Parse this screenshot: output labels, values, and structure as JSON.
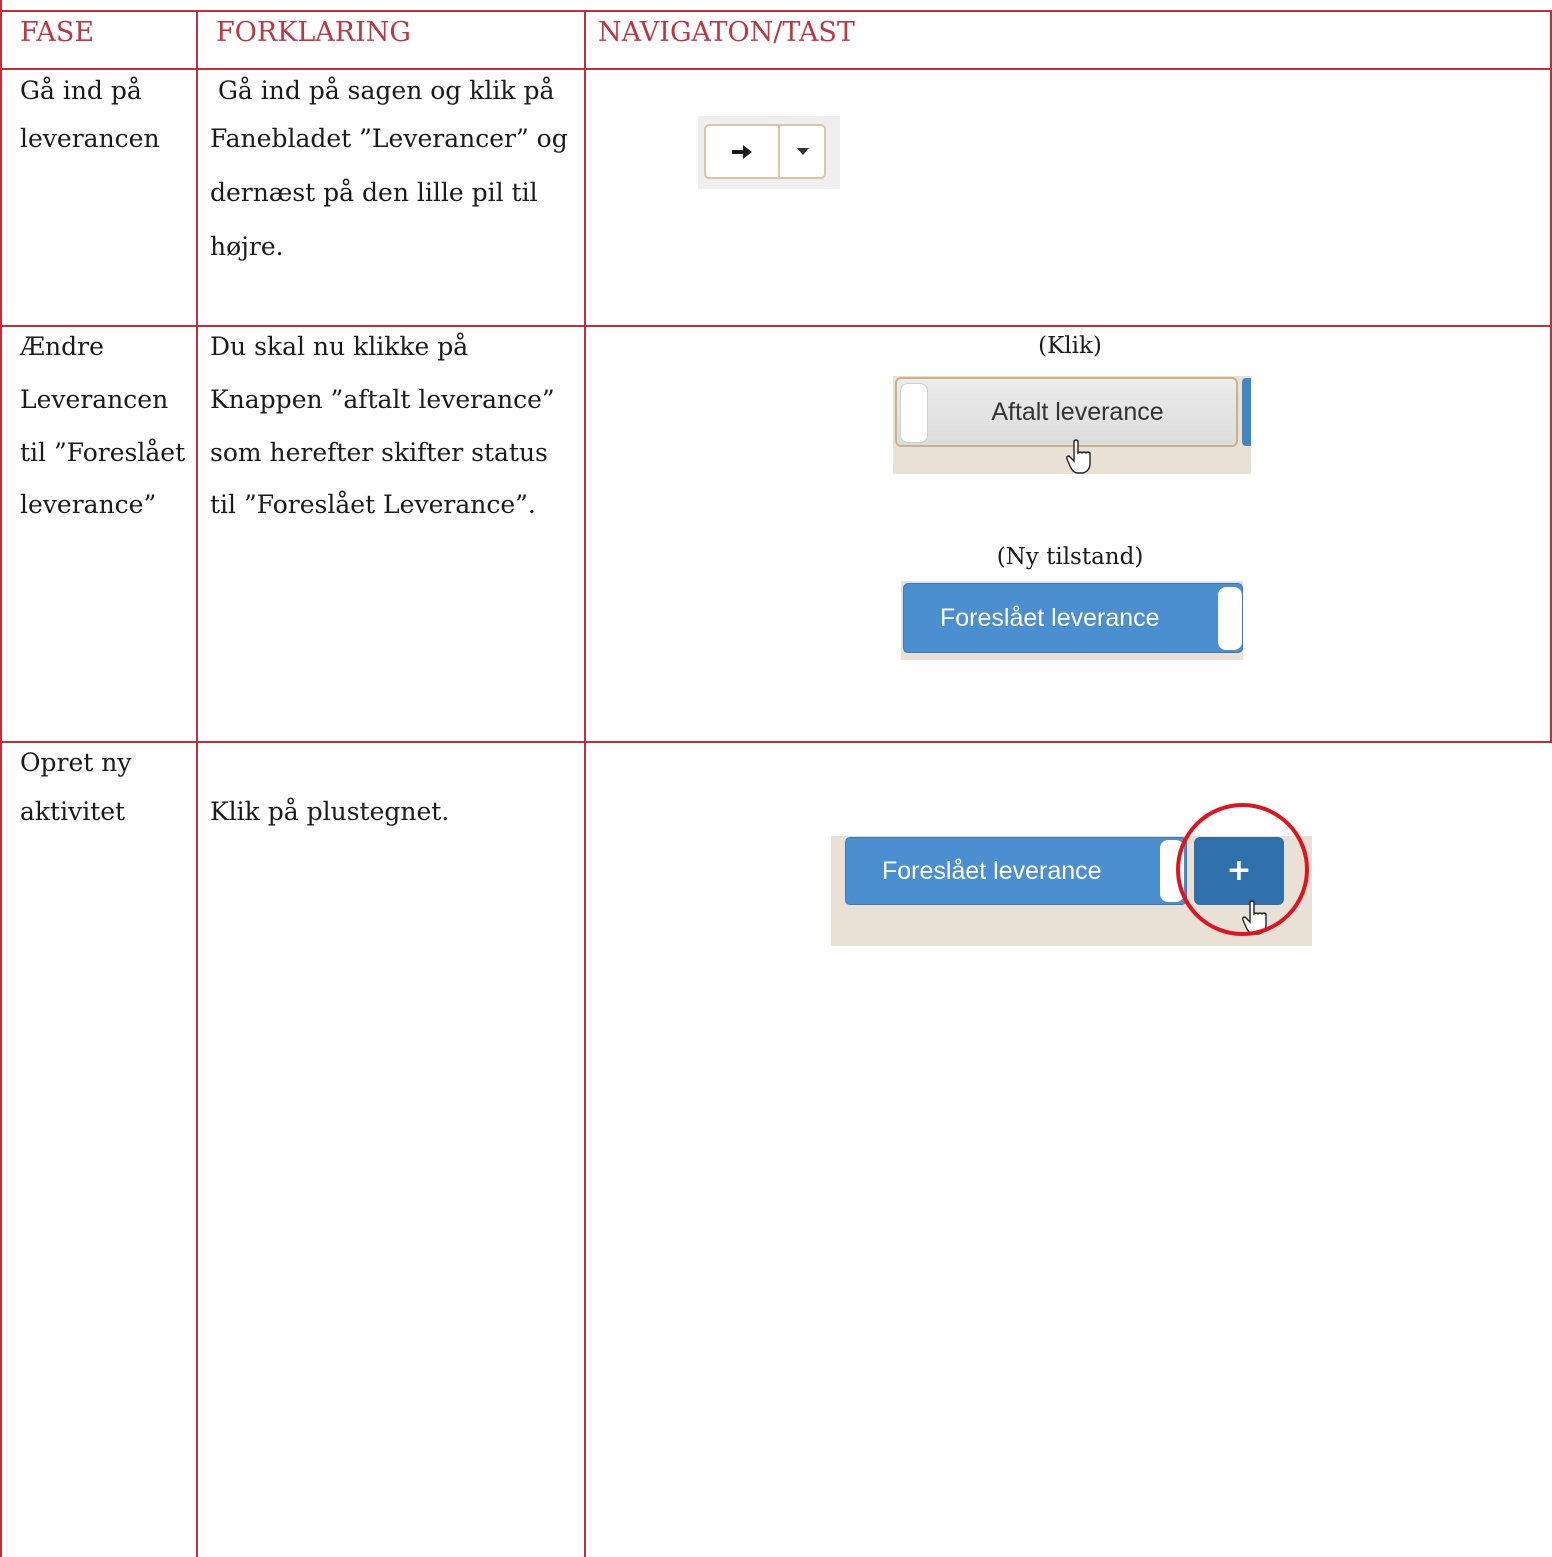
{
  "table": {
    "headers": {
      "phase": "FASE",
      "explanation": "FORKLARING",
      "navigation": "NAVIGATON/TAST"
    },
    "rows": [
      {
        "phase": [
          "Gå ind på",
          "leverancen"
        ],
        "explanation": [
          " Gå ind på sagen og klik på",
          "Fanebladet ”Leverancer” og",
          "dernæst på den lille pil til",
          "højre."
        ]
      },
      {
        "phase": [
          "Ændre",
          "Leverancen",
          "til ”Foreslået",
          "leverance”"
        ],
        "explanation": [
          "Du skal nu klikke på",
          "Knappen ”aftalt leverance”",
          "som herefter skifter status",
          "til ”Foreslået Leverance”."
        ],
        "captions": {
          "click": "(Klik)",
          "new_state": "(Ny tilstand)"
        },
        "buttons": {
          "agreed": "Aftalt leverance",
          "proposed": "Foreslået leverance"
        }
      },
      {
        "phase": [
          "Opret ny",
          "aktivitet"
        ],
        "explanation": [
          "Klik på plustegnet."
        ],
        "buttons": {
          "proposed": "Foreslået leverance",
          "plus": "+"
        }
      }
    ]
  },
  "icons": [
    "arrow-right-icon",
    "caret-down-icon",
    "hand-cursor-icon",
    "plus-icon"
  ],
  "colors": {
    "rule": "#c0303a",
    "header_text": "#c23440",
    "button_blue": "#4b8fd0",
    "button_blue_dark": "#2f6fab",
    "highlight_ring": "#e0141e"
  }
}
